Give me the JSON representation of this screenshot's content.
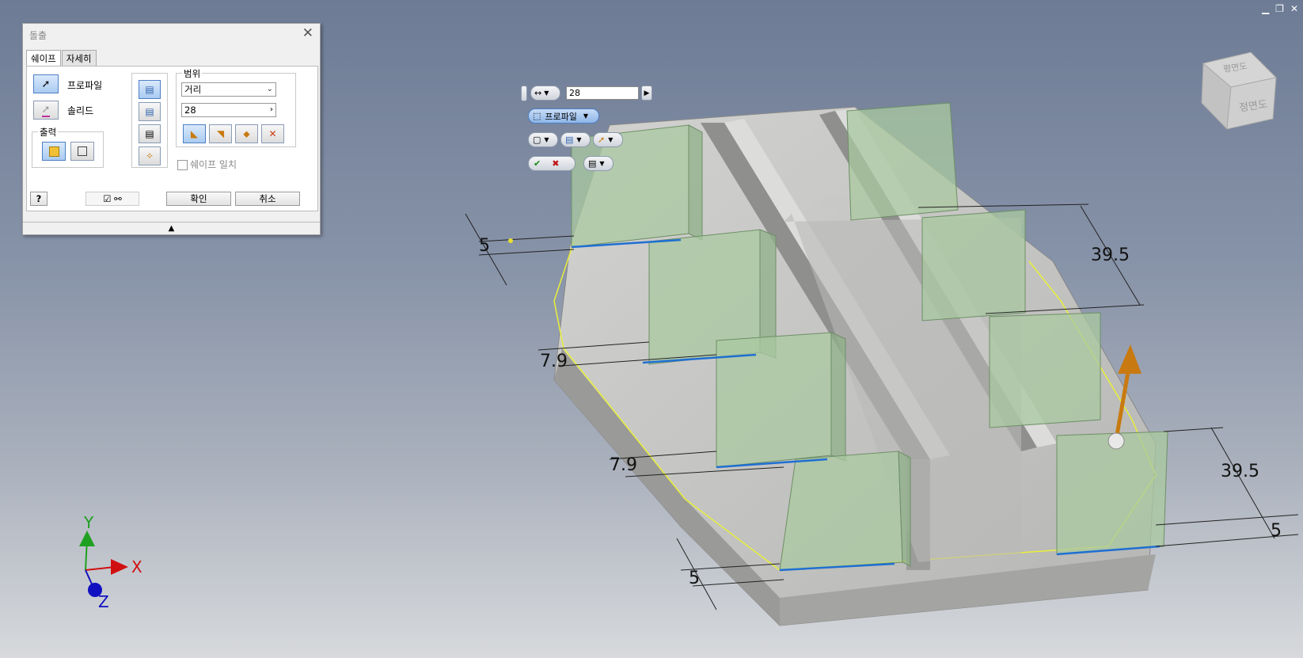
{
  "window_controls": {
    "minimize": "▁",
    "restore": "❐",
    "close": "✕"
  },
  "dialog": {
    "title": "돌출",
    "close_glyph": "✕",
    "tabs": [
      {
        "label": "쉐이프"
      },
      {
        "label": "자세히"
      }
    ],
    "profile_label": "프로파일",
    "solid_label": "솔리드",
    "output_group_label": "출력",
    "extents_group_label": "범위",
    "extent_type": "거리",
    "distance_value": "28",
    "match_shape_label": "쉐이프 일치",
    "ok_label": "확인",
    "cancel_label": "취소",
    "help_glyph": "?",
    "expand_glyph": "▲"
  },
  "minitoolbar": {
    "distance_value": "28",
    "profile_label": "프로파일"
  },
  "dimensions": {
    "top_left": "5",
    "right_upper": "39.5",
    "mid_left_1": "7.9",
    "mid_left_2": "7.9",
    "right_lower": "39.5",
    "right_bottom": "5",
    "bottom_left": "5"
  },
  "triad": {
    "x": "X",
    "y": "Y",
    "z": "Z"
  },
  "viewcube": {
    "face_front": "정면도",
    "face_top": "평면도"
  },
  "colors": {
    "background_top": "#6d7b95",
    "model_face": "#c4c4c2",
    "preview_green": "#a9c9a0",
    "highlight_yellow": "#e9f03a",
    "edge_blue": "#1f6fd1",
    "arrow_orange": "#c87a10",
    "axis_x": "#d01010",
    "axis_y": "#20a020",
    "axis_z": "#1010c0"
  }
}
